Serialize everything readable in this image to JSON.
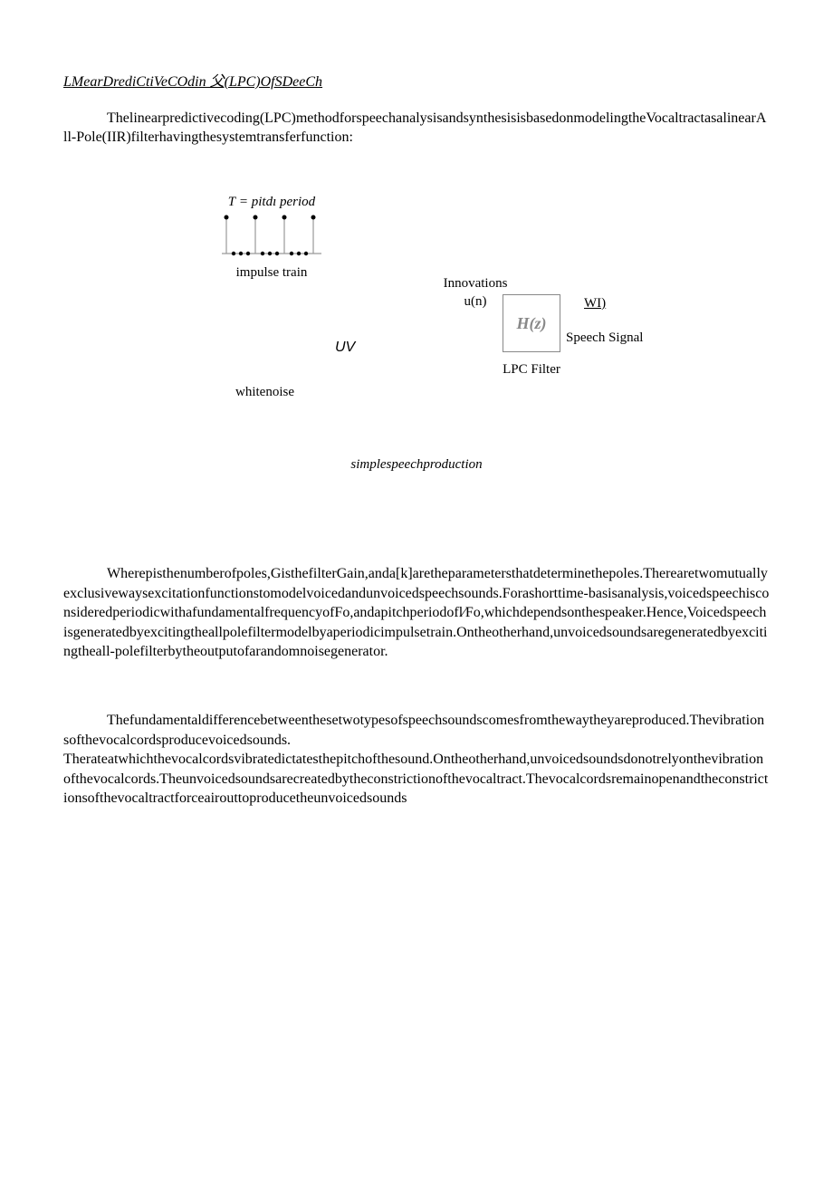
{
  "title": "LMearDrediCtiVeCOdin 父(LPC)OfSDeeCh",
  "intro": "Thelinearpredictivecoding(LPC)methodforspeechanalysisandsynthesisisbasedonmodelingtheVocaltractasalinearAll-Pole(IIR)filterhavingthesystemtransferfunction:",
  "diagram": {
    "pitch_label_prefix": "T",
    "pitch_label_rest": " = pitdı period",
    "impulse_caption": "impulse train",
    "uv": "UV",
    "whitenoise": "whitenoise",
    "innovations": "Innovations",
    "un": "u(n)",
    "hz": "H(z)",
    "lpc_filter": "LPC Filter",
    "wi": "WI)",
    "speech_signal": "Speech Signal"
  },
  "figure_caption": "simplespeechproduction",
  "para2": "Wherepisthenumberofpoles,GisthefilterGain,anda[k]aretheparametersthatdeterminethepoles.Therearetwomutuallyexclusivewaysexcitationfunctionstomodelvoicedandunvoicedspeechsounds.Forashorttime-basisanalysis,voicedspeechisconsideredperiodicwithafundamentalfrequencyofFo,andapitchperiodofl⁄Fo,whichdependsonthespeaker.Hence,Voicedspeechisgeneratedbyexcitingtheallpolefiltermodelbyaperiodicimpulsetrain.Ontheotherhand,unvoicedsoundsaregeneratedbyexcitingtheall-polefilterbytheoutputofarandomnoisegenerator.",
  "para3": "Thefundamentaldifferencebetweenthesetwotypesofspeechsoundscomesfromthewaytheyareproduced.Thevibrationsofthevocalcordsproducevoicedsounds.\nTherateatwhichthevocalcordsvibratedictatesthepitchofthesound.Ontheotherhand,unvoicedsoundsdonotrelyonthevibrationofthevocalcords.Theunvoicedsoundsarecreatedbytheconstrictionofthevocaltract.Thevocalcordsremainopenandtheconstrictionsofthevocaltractforceairouttoproducetheunvoicedsounds"
}
